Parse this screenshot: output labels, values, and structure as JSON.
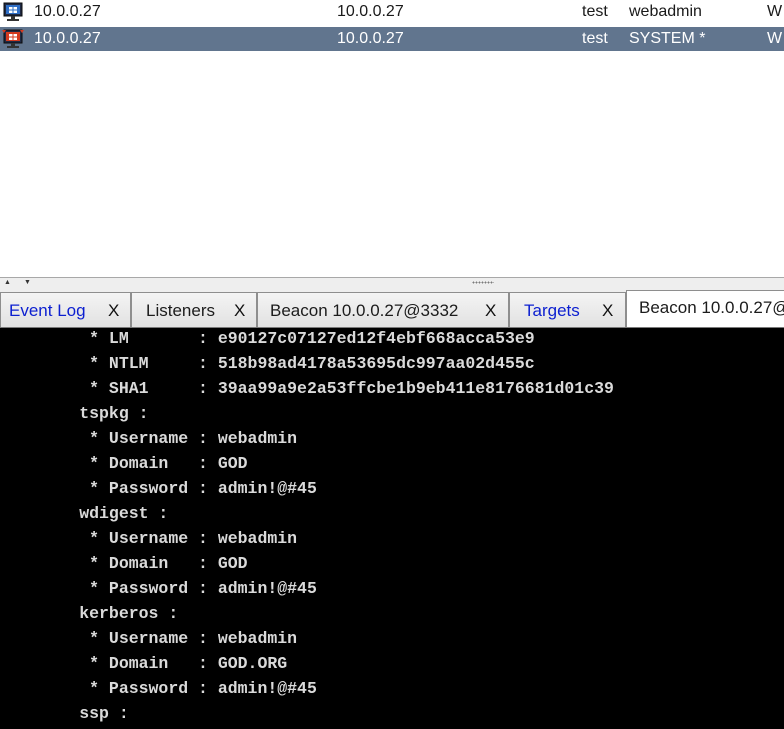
{
  "sessions": [
    {
      "external": "10.0.0.27",
      "internal": "10.0.0.27",
      "listener": "test",
      "user": "webadmin",
      "computer": "W",
      "selected": false
    },
    {
      "external": "10.0.0.27",
      "internal": "10.0.0.27",
      "listener": "test",
      "user": "SYSTEM *",
      "computer": "W",
      "selected": true
    }
  ],
  "divider": {
    "up_arrow": "▲",
    "down_arrow": "▼"
  },
  "tabs": [
    {
      "label": "Event Log",
      "close": "X"
    },
    {
      "label": "Listeners",
      "close": "X"
    },
    {
      "label": "Beacon 10.0.0.27@3332",
      "close": "X"
    },
    {
      "label": "Targets",
      "close": "X"
    },
    {
      "label": "Beacon 10.0.0.27@"
    }
  ],
  "console": {
    "lines": [
      "         * LM       : e90127c07127ed12f4ebf668acca53e9",
      "         * NTLM     : 518b98ad4178a53695dc997aa02d455c",
      "         * SHA1     : 39aa99a9e2a53ffcbe1b9eb411e8176681d01c39",
      "        tspkg :",
      "         * Username : webadmin",
      "         * Domain   : GOD",
      "         * Password : admin!@#45",
      "        wdigest :",
      "         * Username : webadmin",
      "         * Domain   : GOD",
      "         * Password : admin!@#45",
      "        kerberos :",
      "         * Username : webadmin",
      "         * Domain   : GOD.ORG",
      "         * Password : admin!@#45",
      "        ssp :"
    ]
  }
}
